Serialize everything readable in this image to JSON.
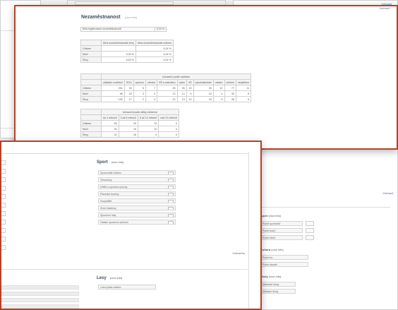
{
  "top_window": {
    "title": "Nezaměstnanost",
    "title_note": "(více info)",
    "more_link": "Zobrazit",
    "selector_label": "Míra registrované nezaměstnanosti",
    "selector_value": "5,24 %",
    "rate_table": {
      "headers": [
        "Míra nezaměstnanosti ženy",
        "Míra nezaměstnanosti celkem"
      ],
      "rows": [
        {
          "label": "Celkem",
          "values": [
            "",
            "5,24 %"
          ]
        },
        {
          "label": "Muži",
          "values": [
            "5,00 %",
            "5,24 %"
          ]
        },
        {
          "label": "Ženy",
          "values": [
            "5,52 %",
            "5,24 %"
          ]
        }
      ]
    },
    "edu_table": {
      "caption": "Uchazeči podle vzdělání",
      "headers": [
        "základní vzdělání",
        "SOU",
        "vyučení",
        "střední",
        "SŠ s maturitou",
        "vyšší",
        "VŠ",
        "vysokoškolské",
        "ostatní",
        "celkem",
        "nezjištěno"
      ],
      "rows": [
        {
          "label": "Celkem",
          "values": [
            "201",
            "35",
            "5",
            "7",
            "26",
            "26",
            "19",
            "30",
            "12",
            "77",
            "11"
          ]
        },
        {
          "label": "Muži",
          "values": [
            "96",
            "18",
            "3",
            "4",
            "13",
            "13",
            "9",
            "15",
            "6",
            "39",
            "6"
          ]
        },
        {
          "label": "Ženy",
          "values": [
            "105",
            "17",
            "2",
            "3",
            "13",
            "13",
            "10",
            "15",
            "6",
            "38",
            "5"
          ]
        }
      ]
    },
    "dur_table": {
      "caption": "Uchazeči podle délky evidence",
      "headers": [
        "do 3 měsíců",
        "3 až 6 měsíců",
        "6 až 12 měsíců",
        "nad 12 měsíců"
      ],
      "rows": [
        {
          "label": "Celkem",
          "values": [
            "65",
            "33",
            "19",
            "9"
          ]
        },
        {
          "label": "Muži",
          "values": [
            "34",
            "15",
            "10",
            "4"
          ]
        },
        {
          "label": "Ženy",
          "values": [
            "31",
            "18",
            "9",
            "5"
          ]
        }
      ]
    },
    "bottom_more_link": "Zobrazit",
    "right_lists": [
      {
        "title": "Sport",
        "note": "(více info)",
        "items": [
          "Počet sportovišť",
          "Počet klubů",
          "Počet členů"
        ]
      },
      {
        "title": "Kultura",
        "note": "(více info)",
        "items": [
          "Počet kin",
          "Počet divadel"
        ]
      },
      {
        "title": "Školy",
        "note": "(více info)",
        "items": [
          "Mateřské školy",
          "Základní školy"
        ]
      }
    ]
  },
  "front_window": {
    "sport_title": "Sport",
    "sport_note": "(více info)",
    "sport_items": [
      "Sportoviště celkem",
      "Tělocvičny",
      "Hřiště a sportovní plochy",
      "Plavecké bazény",
      "Koupaliště",
      "Zimní stadiony",
      "Sportovní haly",
      "Ostatní sportovní zařízení"
    ],
    "more_link": "Zobrazit",
    "lower_title": "Lesy",
    "lower_note": "(více info)",
    "lower_item": "Lesní půda celkem"
  },
  "colors": {
    "frame": "#b6412a",
    "link": "#4a6a95"
  }
}
